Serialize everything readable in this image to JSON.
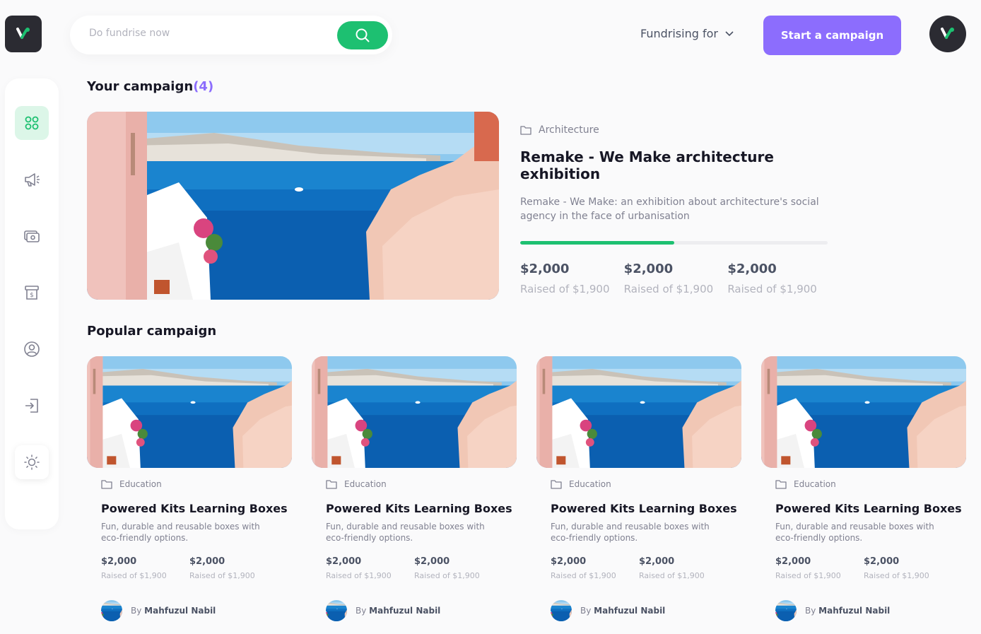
{
  "header": {
    "search_placeholder": "Do fundrise now",
    "fundraising_label": "Fundrising for",
    "start_button": "Start a campaign"
  },
  "sidebar": {
    "items": [
      {
        "icon": "dashboard-icon",
        "active": true
      },
      {
        "icon": "megaphone-icon"
      },
      {
        "icon": "payment-icon"
      },
      {
        "icon": "withdraw-icon"
      },
      {
        "icon": "profile-icon"
      },
      {
        "icon": "logout-icon"
      },
      {
        "icon": "sun-icon"
      }
    ]
  },
  "your_campaign": {
    "title": "Your campaign",
    "count": "(4)",
    "category": "Architecture",
    "name": "Remake - We Make architecture exhibition",
    "description": "Remake - We Make: an exhibition about architecture's social agency in the face of urbanisation",
    "progress": 0.5,
    "stats": [
      {
        "value": "$2,000",
        "label": "Raised of $1,900"
      },
      {
        "value": "$2,000",
        "label": "Raised of $1,900"
      },
      {
        "value": "$2,000",
        "label": "Raised of $1,900"
      }
    ]
  },
  "popular": {
    "title": "Popular campaign",
    "cards": [
      {
        "category": "Education",
        "title": "Powered Kits Learning Boxes",
        "description": "Fun, durable and reusable boxes with eco-friendly options.",
        "stat1_value": "$2,000",
        "stat1_label": "Raised of $1,900",
        "stat2_value": "$2,000",
        "stat2_label": "Raised of $1,900",
        "by": "By",
        "author": "Mahfuzul Nabil"
      },
      {
        "category": "Education",
        "title": "Powered Kits Learning Boxes",
        "description": "Fun, durable and reusable boxes with eco-friendly options.",
        "stat1_value": "$2,000",
        "stat1_label": "Raised of $1,900",
        "stat2_value": "$2,000",
        "stat2_label": "Raised of $1,900",
        "by": "By",
        "author": "Mahfuzul Nabil"
      },
      {
        "category": "Education",
        "title": "Powered Kits Learning Boxes",
        "description": "Fun, durable and reusable boxes with eco-friendly options.",
        "stat1_value": "$2,000",
        "stat1_label": "Raised of $1,900",
        "stat2_value": "$2,000",
        "stat2_label": "Raised of $1,900",
        "by": "By",
        "author": "Mahfuzul Nabil"
      },
      {
        "category": "Education",
        "title": "Powered Kits Learning Boxes",
        "description": "Fun, durable and reusable boxes with eco-friendly options.",
        "stat1_value": "$2,000",
        "stat1_label": "Raised of $1,900",
        "stat2_value": "$2,000",
        "stat2_label": "Raised of $1,900",
        "by": "By",
        "author": "Mahfuzul Nabil"
      }
    ]
  },
  "colors": {
    "primary_green": "#1dc071",
    "accent_purple": "#8c6dfd",
    "dark": "#2b2b32"
  }
}
